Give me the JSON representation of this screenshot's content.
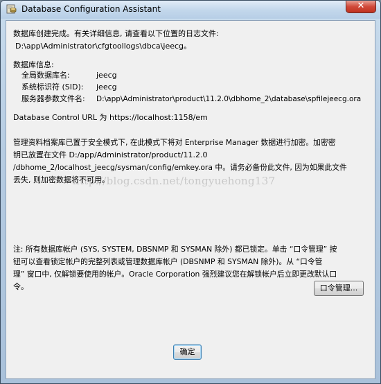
{
  "window": {
    "title": "Database Configuration Assistant",
    "close_glyph": "✕"
  },
  "content": {
    "intro_line1": "数据库创建完成。有关详细信息, 请查看以下位置的日志文件:",
    "intro_line2": "D:\\app\\Administrator\\cfgtoollogs\\dbca\\jeecg。",
    "dbinfo_heading": "数据库信息:",
    "global_name_label": "全局数据库名:",
    "global_name_value": "jeecg",
    "sid_label": "系统标识符 (SID):",
    "sid_value": "jeecg",
    "spfile_label": "服务器参数文件名:",
    "spfile_value": "D:\\app\\Administrator\\product\\11.2.0\\dbhome_2\\database\\spfilejeecg.ora",
    "db_control_url": "Database Control URL 为 https://localhost:1158/em",
    "repo_line1": "管理资料档案库已置于安全模式下, 在此模式下将对 Enterprise Manager 数据进行加密。加密密",
    "repo_line2": "钥已放置在文件 D:/app/Administrator/product/11.2.0",
    "repo_line3": "/dbhome_2/localhost_jeecg/sysman/config/emkey.ora 中。请务必备份此文件, 因为如果此文件",
    "repo_line4": "丢失, 则加密数据将不可用。",
    "watermark": "http://blog.csdn.net/tongyuehong137",
    "note_line1": "注: 所有数据库帐户 (SYS, SYSTEM, DBSNMP 和 SYSMAN 除外) 都已锁定。单击 “口令管理” 按",
    "note_line2": "钮可以查看锁定帐户的完整列表或管理数据库帐户 (DBSNMP 和 SYSMAN 除外)。从 “口令管",
    "note_line3": "理” 窗口中, 仅解锁要使用的帐户。Oracle Corporation 强烈建议您在解锁帐户后立即更改默认口",
    "note_line4": "令。"
  },
  "buttons": {
    "password_management": "口令管理...",
    "ok": "确定"
  }
}
